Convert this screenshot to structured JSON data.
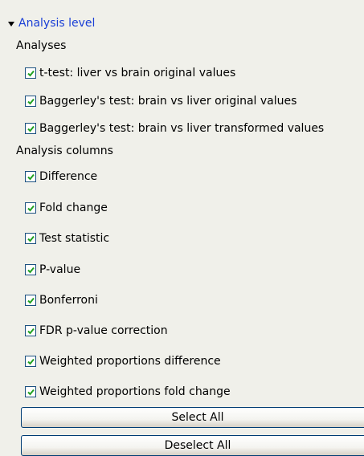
{
  "section": {
    "title": "Analysis level",
    "expanded": true
  },
  "analyses": {
    "label": "Analyses",
    "items": [
      {
        "label": "t-test: liver vs brain original values",
        "checked": true
      },
      {
        "label": "Baggerley's test: brain vs liver original values",
        "checked": true
      },
      {
        "label": "Baggerley's test: brain vs liver transformed values",
        "checked": true
      }
    ]
  },
  "columns": {
    "label": "Analysis columns",
    "items": [
      {
        "label": "Difference",
        "checked": true
      },
      {
        "label": "Fold change",
        "checked": true
      },
      {
        "label": "Test statistic",
        "checked": true
      },
      {
        "label": "P-value",
        "checked": true
      },
      {
        "label": "Bonferroni",
        "checked": true
      },
      {
        "label": "FDR p-value correction",
        "checked": true
      },
      {
        "label": "Weighted proportions difference",
        "checked": true
      },
      {
        "label": "Weighted proportions fold change",
        "checked": true
      }
    ]
  },
  "buttons": {
    "select_all": "Select All",
    "deselect_all": "Deselect All"
  },
  "colors": {
    "header_link": "#1a3fd6",
    "checkmark": "#21a121",
    "checkbox_border": "#1c5180",
    "background": "#f0f0ea"
  }
}
